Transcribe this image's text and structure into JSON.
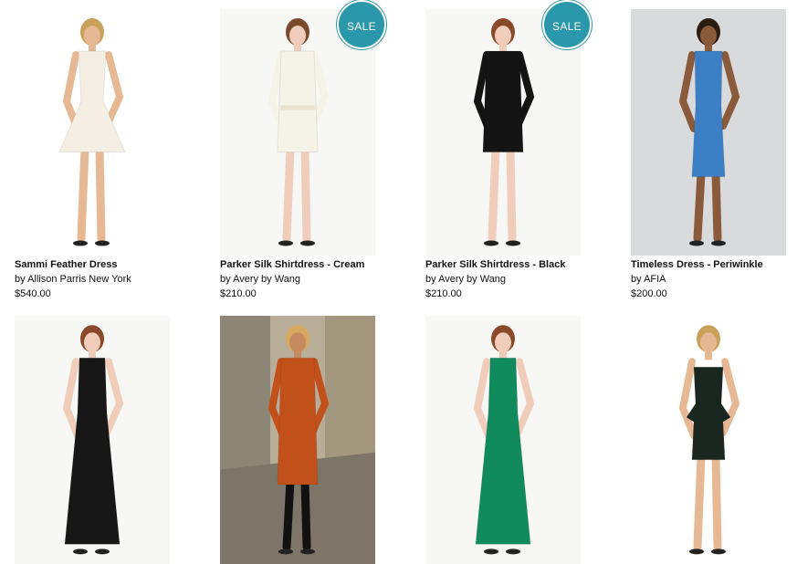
{
  "products": [
    {
      "name": "Sammi Feather Dress",
      "brand": "by Allison Parris New York",
      "price": "$540.00",
      "sale": "",
      "dress_color": "#f4efe2",
      "skin": "#e6b893",
      "hair": "#c9a15a"
    },
    {
      "name": "Parker Silk Shirtdress - Cream",
      "brand": "by Avery by Wang",
      "price": "$210.00",
      "sale": "SALE",
      "dress_color": "#f5f2e6",
      "skin": "#f0cdbb",
      "hair": "#7a4a2e"
    },
    {
      "name": "Parker Silk Shirtdress - Black",
      "brand": "by Avery by Wang",
      "price": "$210.00",
      "sale": "SALE",
      "dress_color": "#141414",
      "skin": "#f0cdbb",
      "hair": "#8a4a2a"
    },
    {
      "name": "Timeless Dress - Periwinkle",
      "brand": "by AFIA",
      "price": "$200.00",
      "sale": "",
      "dress_color": "#3d7fc4",
      "skin": "#8a5a3c",
      "hair": "#2b1d14"
    },
    {
      "name": "",
      "brand": "",
      "price": "",
      "sale": "",
      "dress_color": "#171717",
      "skin": "#f0cdbb",
      "hair": "#8a4a2a"
    },
    {
      "name": "",
      "brand": "",
      "price": "",
      "sale": "",
      "dress_color": "#c2501a",
      "skin": "#c48a60",
      "hair": "#d8a860"
    },
    {
      "name": "",
      "brand": "",
      "price": "",
      "sale": "",
      "dress_color": "#118a5e",
      "skin": "#f0cdbb",
      "hair": "#8a4a2a"
    },
    {
      "name": "",
      "brand": "",
      "price": "",
      "sale": "",
      "dress_color": "#1a2620",
      "skin": "#e6b893",
      "hair": "#c9a15a"
    }
  ]
}
